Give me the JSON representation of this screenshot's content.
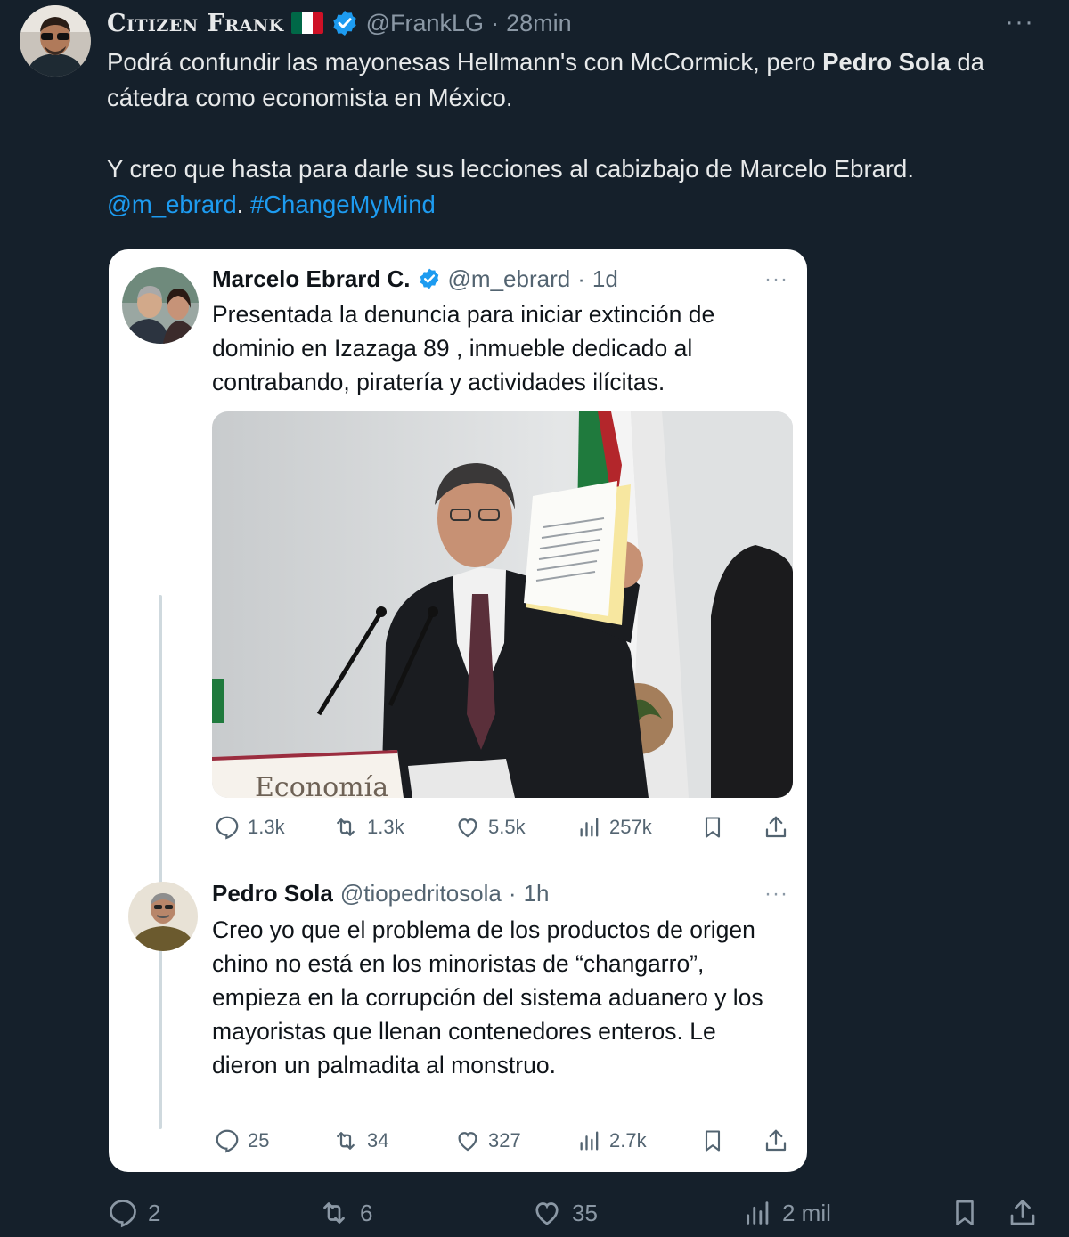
{
  "tweet": {
    "display_name": "Citizen Frank",
    "handle": "@FrankLG",
    "separator": "·",
    "time": "28min",
    "more": "···",
    "text_line1_pre": "Podrá confundir las mayonesas Hellmann's con McCormick, pero ",
    "text_line1_bold": "Pedro Sola",
    "text_line1_post": " da cátedra como economista en México.",
    "text_line2": "Y creo que hasta para darle sus lecciones al cabizbajo de Marcelo Ebrard.",
    "mention": "@m_ebrard",
    "mention_sep": ". ",
    "hashtag": "#ChangeMyMind",
    "counts": {
      "replies": "2",
      "retweets": "6",
      "likes": "35",
      "views": "2 mil"
    }
  },
  "quoted": {
    "first": {
      "name": "Marcelo Ebrard C.",
      "handle": "@m_ebrard",
      "separator": "·",
      "time": "1d",
      "more": "···",
      "text": "Presentada la denuncia para iniciar extinción de dominio en Izazaga  89 , inmueble dedicado al contrabando, piratería y actividades ilícitas.",
      "photo_sign": "Economía",
      "counts": {
        "replies": "1.3k",
        "retweets": "1.3k",
        "likes": "5.5k",
        "views": "257k"
      }
    },
    "second": {
      "name": "Pedro Sola",
      "handle": "@tiopedritosola",
      "separator": "·",
      "time": "1h",
      "more": "···",
      "text": "Creo yo que el problema de los productos de origen chino no está en los minoristas de “changarro”, empieza en la corrupción del sistema aduanero y los mayoristas que llenan contenedores enteros. Le dieron un palmadita al monstruo.",
      "counts": {
        "replies": "25",
        "retweets": "34",
        "likes": "327",
        "views": "2.7k"
      }
    }
  },
  "colors": {
    "background": "#15202b",
    "link": "#1d9bf0",
    "card": "#ffffff",
    "muted": "#8b98a5",
    "verified": "#1d9bf0"
  }
}
